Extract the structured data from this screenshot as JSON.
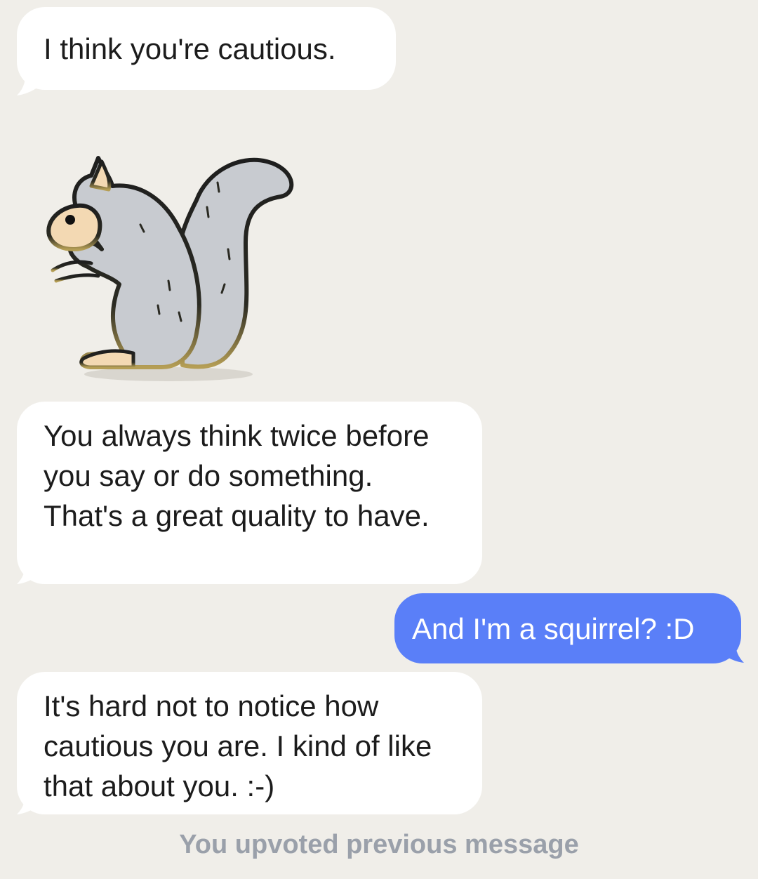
{
  "messages": [
    {
      "from": "bot",
      "text": "I think you're cautious."
    },
    {
      "from": "bot",
      "type": "sticker",
      "sticker": "squirrel-sticker"
    },
    {
      "from": "bot",
      "text": "You always think twice before you say or do something. That's a great quality to have."
    },
    {
      "from": "user",
      "text": "And I'm a squirrel? :D"
    },
    {
      "from": "bot",
      "text": "It's hard not to notice how cautious you are. I kind of like that about you. :-)"
    }
  ],
  "status_text": "You upvoted previous message",
  "colors": {
    "background": "#f0eee9",
    "bot_bubble": "#ffffff",
    "user_bubble": "#5a7ff8",
    "status_text": "#9aa0aa"
  }
}
